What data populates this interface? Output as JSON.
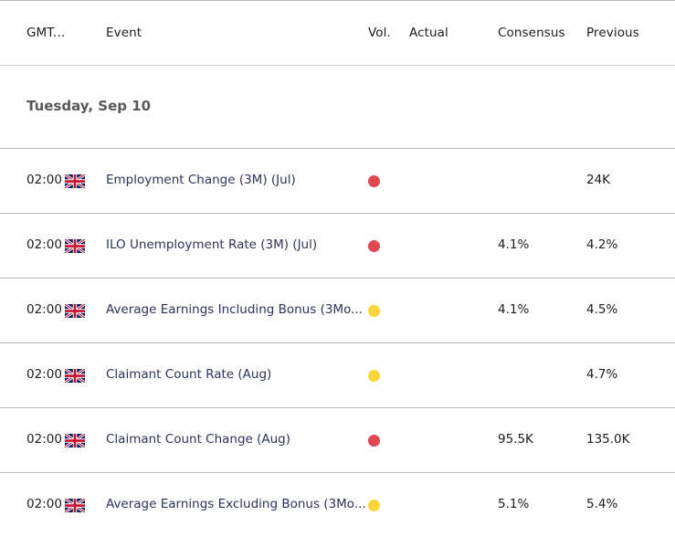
{
  "header": {
    "columns": {
      "time": "GMT...",
      "event": "Event",
      "volatility": "Vol.",
      "actual": "Actual",
      "consensus": "Consensus",
      "previous": "Previous"
    }
  },
  "date_group": {
    "label": "Tuesday, Sep 10"
  },
  "colors": {
    "high": "#e04752",
    "medium": "#fcd53b"
  },
  "rows": [
    {
      "time": "02:00",
      "country": "UK",
      "flag_icon": "uk-flag-icon",
      "event": "Employment Change (3M) (Jul)",
      "volatility": "high",
      "actual": "",
      "consensus": "",
      "previous": "24K"
    },
    {
      "time": "02:00",
      "country": "UK",
      "flag_icon": "uk-flag-icon",
      "event": "ILO Unemployment Rate (3M) (Jul)",
      "volatility": "high",
      "actual": "",
      "consensus": "4.1%",
      "previous": "4.2%"
    },
    {
      "time": "02:00",
      "country": "UK",
      "flag_icon": "uk-flag-icon",
      "event": "Average Earnings Including Bonus (3Mo...",
      "volatility": "medium",
      "actual": "",
      "consensus": "4.1%",
      "previous": "4.5%"
    },
    {
      "time": "02:00",
      "country": "UK",
      "flag_icon": "uk-flag-icon",
      "event": "Claimant Count Rate (Aug)",
      "volatility": "medium",
      "actual": "",
      "consensus": "",
      "previous": "4.7%"
    },
    {
      "time": "02:00",
      "country": "UK",
      "flag_icon": "uk-flag-icon",
      "event": "Claimant Count Change (Aug)",
      "volatility": "high",
      "actual": "",
      "consensus": "95.5K",
      "previous": "135.0K"
    },
    {
      "time": "02:00",
      "country": "UK",
      "flag_icon": "uk-flag-icon",
      "event": "Average Earnings Excluding Bonus (3Mo...",
      "volatility": "medium",
      "actual": "",
      "consensus": "5.1%",
      "previous": "5.4%"
    }
  ]
}
